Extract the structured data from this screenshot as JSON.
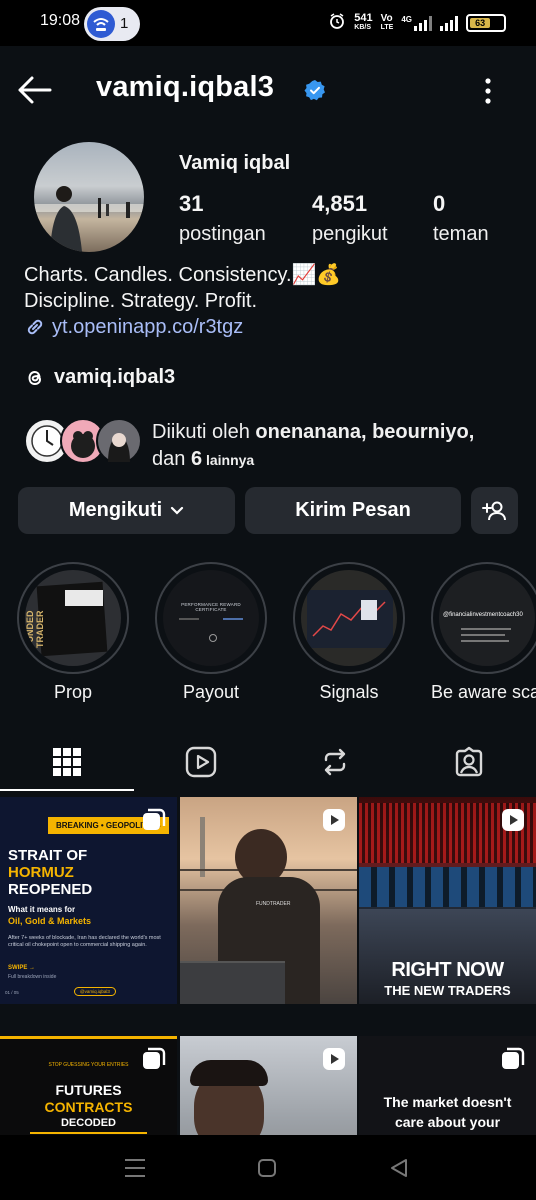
{
  "status_bar": {
    "time": "19:08",
    "hotspot_count": "1",
    "speed_value": "541",
    "speed_unit": "KB/S",
    "volte": "Vo",
    "volte_sub": "LTE",
    "network": "4G",
    "battery": "63"
  },
  "header": {
    "username": "vamiq.iqbal3"
  },
  "profile": {
    "display_name": "Vamiq iqbal",
    "stats": [
      {
        "value": "31",
        "label": "postingan"
      },
      {
        "value": "4,851",
        "label": "pengikut"
      },
      {
        "value": "0",
        "label": "teman"
      }
    ],
    "bio_line1": "Charts. Candles. Consistency.📈💰",
    "bio_line2": "Discipline. Strategy. Profit.",
    "link": "yt.openinapp.co/r3tgz",
    "threads_handle": "vamiq.iqbal3",
    "followed_prefix": "Diikuti oleh ",
    "followed_names": "onenanana, beourniyo,",
    "followed_suffix_1": "dan ",
    "followed_count": "6",
    "followed_suffix_2": " lainnya"
  },
  "actions": {
    "follow_label": "Mengikuti",
    "message_label": "Kirim Pesan"
  },
  "highlights": [
    {
      "label": "Prop",
      "image_text": "FUNDED TRADER"
    },
    {
      "label": "Payout",
      "image_text": "PERFORMANCE REWARD CERTIFICATE"
    },
    {
      "label": "Signals",
      "image_text": ""
    },
    {
      "label": "Be aware sca",
      "image_text": "@financialinvestmentcoach30"
    }
  ],
  "tabs": [
    "grid",
    "reels",
    "reposts",
    "tagged"
  ],
  "posts": [
    {
      "tag": "BREAKING • GEOPOLITICS",
      "title_1": "STRAIT OF",
      "title_2": "HORMUZ",
      "title_3": "REOPENED",
      "subtitle": "What it means for",
      "subtitle_accent": "Oil, Gold & Markets",
      "body": "After 7+ weeks of blockade, Iran has declared the world's most critical oil chokepoint open to commercial shipping again.",
      "swipe": "SWIPE →",
      "swipe_sub": "Full breakdown inside",
      "page": "01 / 05",
      "handle": "@vamiq.iqbal3"
    },
    {
      "shirt_text": "FUNDTRADER"
    },
    {
      "headline_1": "RIGHT NOW",
      "headline_2": "THE NEW TRADERS"
    },
    {
      "tag": "STOP GUESSING YOUR ENTRIES",
      "title_1": "FUTURES",
      "title_2": "CONTRACTS",
      "title_3": "DECODED"
    },
    {},
    {
      "text_1": "The market doesn't",
      "text_2": "care about your"
    }
  ],
  "colors": {
    "app_bg": "#0c1014",
    "button_bg": "#262a30",
    "link": "#a9bdf7",
    "verified": "#3897f0",
    "post_accent": "#f5b400"
  }
}
